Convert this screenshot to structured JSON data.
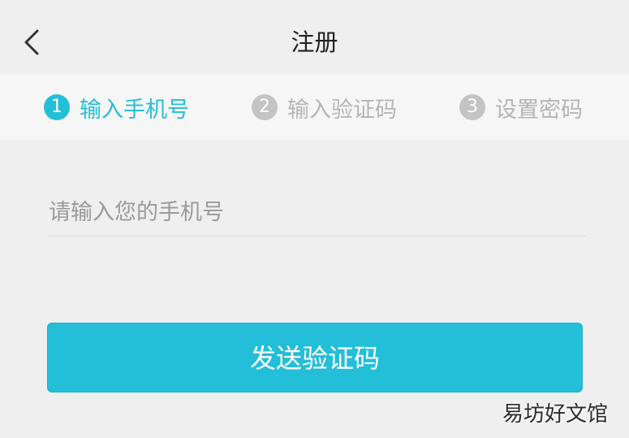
{
  "header": {
    "title": "注册"
  },
  "steps": [
    {
      "number": "1",
      "label": "输入手机号",
      "state": "active"
    },
    {
      "number": "2",
      "label": "输入验证码",
      "state": "inactive"
    },
    {
      "number": "3",
      "label": "设置密码",
      "state": "inactive"
    }
  ],
  "form": {
    "phone_placeholder": "请输入您的手机号",
    "phone_value": ""
  },
  "actions": {
    "send_code_label": "发送验证码"
  },
  "watermark": {
    "text": "易坊好文馆"
  },
  "colors": {
    "accent": "#22bfd8",
    "inactive_step": "#c4c4c4",
    "background": "#efefef"
  },
  "icons": {
    "back": "chevron-left-icon"
  }
}
